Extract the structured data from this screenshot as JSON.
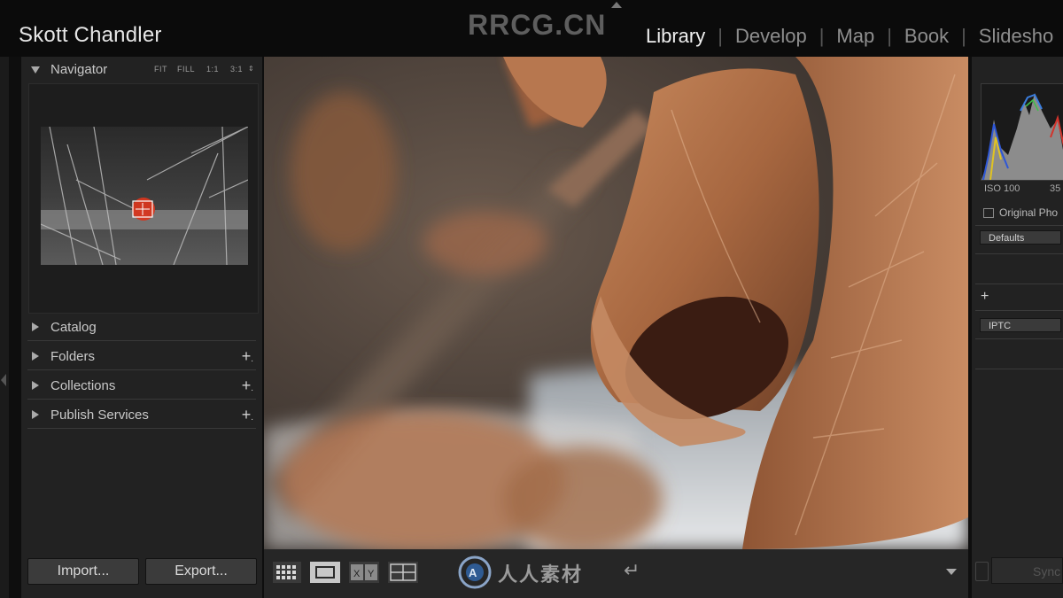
{
  "identity": {
    "name": "Skott Chandler"
  },
  "watermark": "RRCG.CN",
  "modules": [
    {
      "label": "Library",
      "active": true
    },
    {
      "label": "Develop",
      "active": false
    },
    {
      "label": "Map",
      "active": false
    },
    {
      "label": "Book",
      "active": false
    },
    {
      "label": "Slidesho",
      "active": false
    }
  ],
  "left_panel": {
    "navigator": {
      "title": "Navigator",
      "zoom_options": [
        "FIT",
        "FILL",
        "1:1",
        "3:1"
      ]
    },
    "sections": [
      {
        "label": "Catalog",
        "has_add": false
      },
      {
        "label": "Folders",
        "has_add": true
      },
      {
        "label": "Collections",
        "has_add": true
      },
      {
        "label": "Publish Services",
        "has_add": true
      }
    ],
    "import_label": "Import...",
    "export_label": "Export..."
  },
  "right_panel": {
    "histogram": {
      "iso": "ISO 100",
      "focal": "35"
    },
    "original_photo_label": "Original Pho",
    "defaults_label": "Defaults",
    "metadata_preset": "IPTC",
    "sync_label": "Sync"
  },
  "toolbar": {
    "icons": [
      "grid-view-icon",
      "loupe-view-icon",
      "compare-view-icon",
      "survey-view-icon"
    ],
    "compare_label": "X|Y",
    "logo_text": "人人素材"
  },
  "colors": {
    "active_module": "#f0f0f0",
    "inactive_module": "#8e8e8e",
    "panel_bg": "#222222",
    "topbar_bg": "#0b0b0b"
  }
}
